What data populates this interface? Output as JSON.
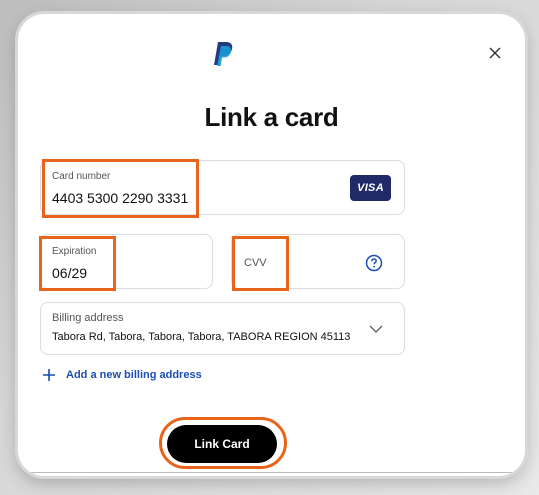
{
  "modal": {
    "title": "Link a card",
    "close_icon": "close-icon",
    "logo_icon": "paypal-logo-icon"
  },
  "card_number": {
    "label": "Card number",
    "value": "4403 5300 2290 3331",
    "brand": "VISA"
  },
  "expiration": {
    "label": "Expiration",
    "value": "06/29"
  },
  "cvv": {
    "label": "CVV",
    "help_icon": "question-circle-icon"
  },
  "billing": {
    "label": "Billing address",
    "value": "Tabora Rd, Tabora, Tabora, Tabora, TABORA REGION 45113",
    "chevron_icon": "chevron-down-icon"
  },
  "add_address": {
    "label": "Add a new billing address",
    "icon": "plus-icon"
  },
  "submit": {
    "label": "Link Card"
  },
  "colors": {
    "highlight": "#e8641b",
    "link": "#1b4db3",
    "visa": "#1f2a66",
    "button": "#000000"
  }
}
